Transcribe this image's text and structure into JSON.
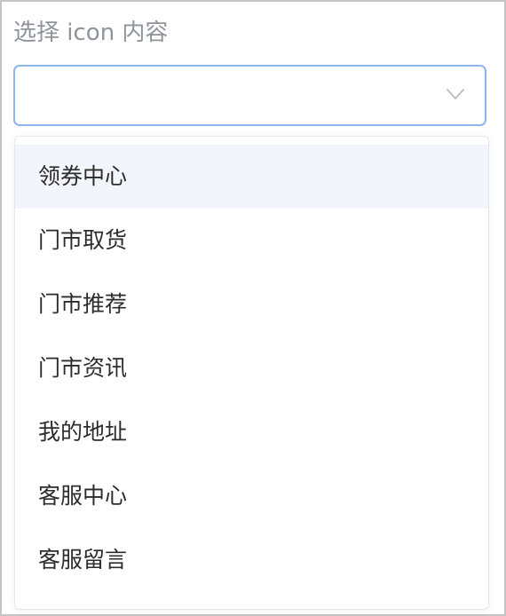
{
  "field": {
    "label": "选择 icon 内容",
    "value": "",
    "chevron_icon": "chevron-down-icon"
  },
  "dropdown": {
    "options": [
      {
        "label": "领券中心",
        "hovered": true
      },
      {
        "label": "门市取货",
        "hovered": false
      },
      {
        "label": "门市推荐",
        "hovered": false
      },
      {
        "label": "门市资讯",
        "hovered": false
      },
      {
        "label": "我的地址",
        "hovered": false
      },
      {
        "label": "客服中心",
        "hovered": false
      },
      {
        "label": "客服留言",
        "hovered": false
      }
    ]
  },
  "colors": {
    "focus_border": "#8fb3ec",
    "hover_background": "#f2f6fc",
    "label_text": "#8f949b",
    "option_text": "#2c2c2c"
  }
}
